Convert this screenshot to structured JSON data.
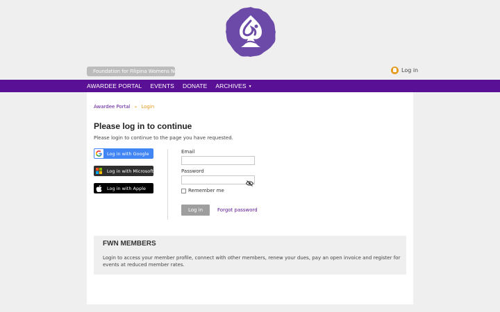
{
  "header": {
    "site_name": "Foundation for Filipina Womens Network",
    "login_label": "Log in",
    "logo_icon": "fwn-logo-icon",
    "brand_color": "#5a1094",
    "accent_color": "#e59b1e"
  },
  "nav": {
    "items": [
      {
        "label": "AWARDEE PORTAL"
      },
      {
        "label": "EVENTS"
      },
      {
        "label": "DONATE"
      },
      {
        "label": "ARCHIVES"
      }
    ],
    "archives_arrow": "▼"
  },
  "breadcrumb": {
    "home": "Awardee Portal",
    "separator": "»",
    "current": "Login"
  },
  "page": {
    "title": "Please log in to continue",
    "subtitle": "Please login to continue to the page you have requested."
  },
  "sso": {
    "google": "Log in with Google",
    "microsoft": "Log in with Microsoft",
    "apple": "Log in with Apple"
  },
  "form": {
    "email_label": "Email",
    "email_value": "",
    "password_label": "Password",
    "password_value": "",
    "remember_label": "Remember me",
    "submit_label": "Log in",
    "forgot_label": "Forgot password"
  },
  "members": {
    "title": "FWN MEMBERS",
    "text": "Login to access your member profile, connect with other members, renew your dues, pay an open invoice and register for events at reduced member rates."
  }
}
